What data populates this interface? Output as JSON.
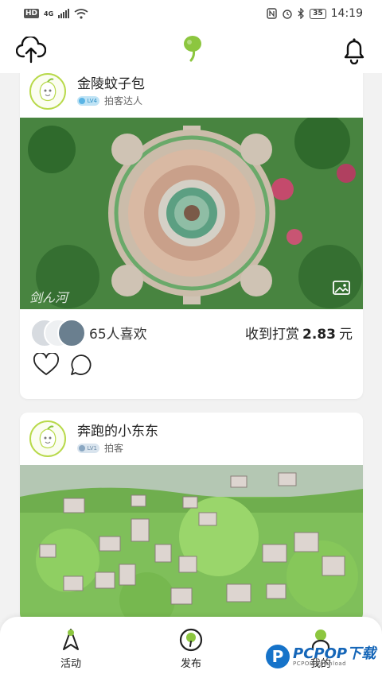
{
  "status_bar": {
    "hd": "HD",
    "network": "4G",
    "time": "14:19",
    "battery": "35"
  },
  "header": {
    "upload_icon": "cloud-upload-icon",
    "logo": "leaf-logo",
    "bell_icon": "bell-icon"
  },
  "posts": [
    {
      "username": "金陵蚊子包",
      "level": "LV4",
      "role": "拍客达人",
      "likes_text": "65人喜欢",
      "reward_prefix": "收到打赏",
      "reward_amount": "2.83",
      "reward_unit": "元",
      "photo_signature": "剑ん河"
    },
    {
      "username": "奔跑的小东东",
      "level": "LV1",
      "role": "拍客"
    }
  ],
  "bottom_nav": {
    "items": [
      {
        "label": "活动"
      },
      {
        "label": "发布"
      },
      {
        "label": "我的"
      }
    ]
  },
  "watermark": {
    "main": "PCPOP下载",
    "sub": "PCPOP Download"
  },
  "colors": {
    "accent_green": "#8cc63f",
    "level_blue": "#5ab4e5"
  }
}
